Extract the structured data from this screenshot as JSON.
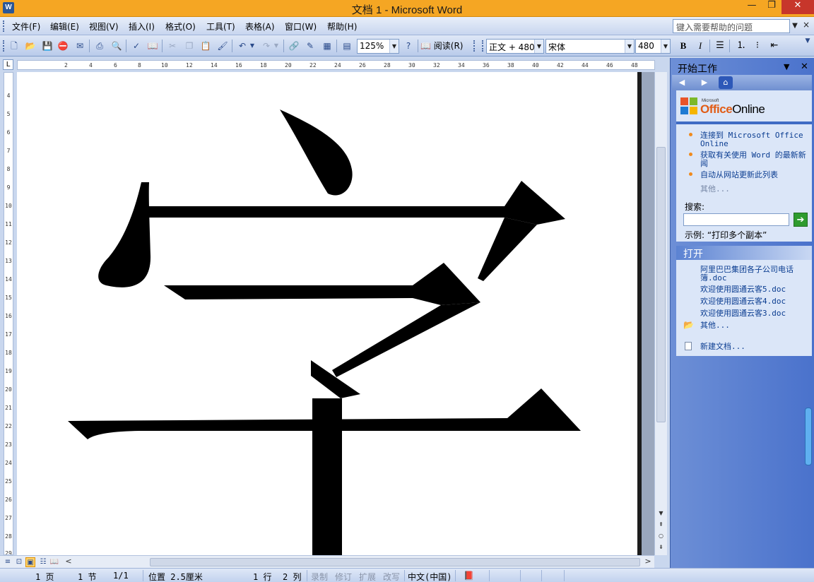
{
  "window": {
    "title": "文档 1 - Microsoft Word",
    "app_icon": "W",
    "minimize": "—",
    "maximize": "❐",
    "close": "✕"
  },
  "menu": {
    "items": [
      "文件(F)",
      "编辑(E)",
      "视图(V)",
      "插入(I)",
      "格式(O)",
      "工具(T)",
      "表格(A)",
      "窗口(W)",
      "帮助(H)"
    ],
    "help_placeholder": "键入需要帮助的问题",
    "help_close": "×"
  },
  "toolbar": {
    "zoom": "125%",
    "read_label": "阅读(R)",
    "style": "正文 + 480",
    "font": "宋体",
    "size": "480",
    "bold": "B",
    "italic": "I"
  },
  "ruler": {
    "corner": "L",
    "h_ticks": [
      "2",
      "4",
      "6",
      "8",
      "10",
      "12",
      "14",
      "16",
      "18",
      "20",
      "22",
      "24",
      "26",
      "28",
      "30",
      "32",
      "34",
      "36",
      "38",
      "40",
      "42",
      "44",
      "46",
      "48"
    ],
    "v_ticks": [
      "4",
      "5",
      "6",
      "7",
      "8",
      "9",
      "10",
      "11",
      "12",
      "13",
      "14",
      "15",
      "16",
      "17",
      "18",
      "19",
      "20",
      "21",
      "22",
      "23",
      "24",
      "25",
      "26",
      "27",
      "28",
      "29"
    ]
  },
  "document": {
    "character": "字",
    "scroll_up": "▲",
    "scroll_down": "▼",
    "scroll_left": "<",
    "scroll_right": ">"
  },
  "status": {
    "page": "1 页",
    "section": "1 节",
    "pages": "1/1",
    "position": "位置 2.5厘米",
    "line": "1 行",
    "column": "2 列",
    "rec": "录制",
    "trk": "修订",
    "ext": "扩展",
    "ovr": "改写",
    "language": "中文(中国)"
  },
  "taskpane": {
    "title": "开始工作",
    "logo_ms": "Microsoft",
    "logo_office": "Office",
    "logo_online": "Online",
    "links": [
      "连接到 Microsoft Office Online",
      "获取有关使用 Word 的最新新闻",
      "自动从网站更新此列表"
    ],
    "more": "其他...",
    "search_label": "搜索:",
    "example": "示例: “打印多个副本”",
    "open_title": "打开",
    "recent_files": [
      "阿里巴巴集团各子公司电话簿.doc",
      "欢迎使用圆通云客5.doc",
      "欢迎使用圆通云客4.doc",
      "欢迎使用圆通云客3.doc"
    ],
    "open_more": "其他...",
    "new_doc": "新建文档..."
  },
  "colors": {
    "titlebar": "#f5a623",
    "taskpane": "#4a72cc",
    "link": "#0b3d91",
    "bullet": "#f08a1c"
  }
}
